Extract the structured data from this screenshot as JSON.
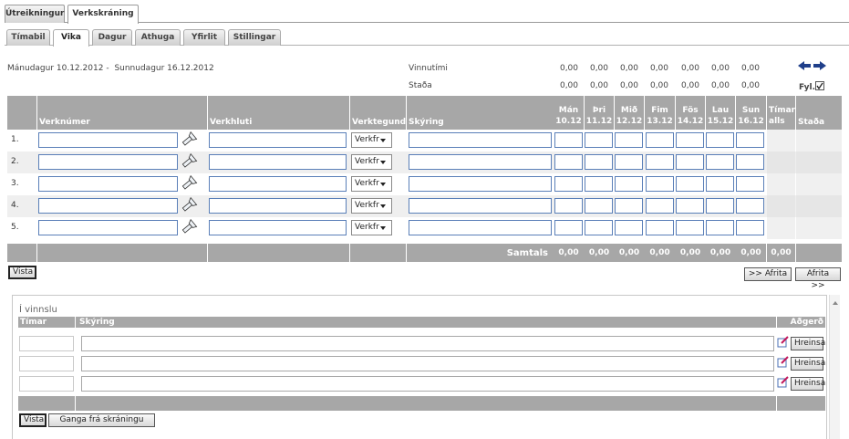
{
  "top_tabs": [
    {
      "label": "Útreikningur",
      "active": false
    },
    {
      "label": "Verkskráning",
      "active": true
    }
  ],
  "sub_tabs": [
    {
      "label": "Tímabil",
      "active": false
    },
    {
      "label": "Vika",
      "active": true
    },
    {
      "label": "Dagur",
      "active": false
    },
    {
      "label": "Athuga",
      "active": false
    },
    {
      "label": "Yfirlit",
      "active": false
    },
    {
      "label": "Stillingar",
      "active": false
    }
  ],
  "period": {
    "start": "Mánudagur 10.12.2012",
    "separator": "-",
    "end": "Sunnudagur 16.12.2012"
  },
  "summary": {
    "vinnutimi_label": "Vinnutími",
    "vinnutimi_values": [
      "0,00",
      "0,00",
      "0,00",
      "0,00",
      "0,00",
      "0,00",
      "0,00"
    ],
    "stada_label": "Staða",
    "stada_values": [
      "0,00",
      "0,00",
      "0,00",
      "0,00",
      "0,00",
      "0,00",
      "0,00"
    ],
    "fyl_label": "Fyl.",
    "fyl_checked": true
  },
  "grid": {
    "headers": {
      "verknumer": "Verknúmer",
      "verkhluti": "Verkhluti",
      "verktegund": "Verktegund",
      "skyring": "Skýring",
      "timar_line1": "Tímar",
      "timar_line2": "alls",
      "stada": "Staða"
    },
    "days": [
      {
        "name": "Mán",
        "date": "10.12"
      },
      {
        "name": "Þri",
        "date": "11.12"
      },
      {
        "name": "Mið",
        "date": "12.12"
      },
      {
        "name": "Fim",
        "date": "13.12"
      },
      {
        "name": "Fös",
        "date": "14.12"
      },
      {
        "name": "Lau",
        "date": "15.12"
      },
      {
        "name": "Sun",
        "date": "16.12"
      }
    ],
    "rows": [
      {
        "num": "1.",
        "verktegund": "Verkfr"
      },
      {
        "num": "2.",
        "verktegund": "Verkfr"
      },
      {
        "num": "3.",
        "verktegund": "Verkfr"
      },
      {
        "num": "4.",
        "verktegund": "Verkfr"
      },
      {
        "num": "5.",
        "verktegund": "Verkfr"
      }
    ],
    "totals_label": "Samtals",
    "totals": [
      "0,00",
      "0,00",
      "0,00",
      "0,00",
      "0,00",
      "0,00",
      "0,00"
    ],
    "total_all": "0,00"
  },
  "buttons": {
    "vista": "Vista",
    "afrita_prev": ">> Afrita",
    "afrita_next": "Afrita >>"
  },
  "panel": {
    "title": "Í vinnslu",
    "headers": {
      "timar": "Tímar",
      "skyring": "Skýring",
      "adgerd": "Aðgerð"
    },
    "rows": [
      {
        "button": "Hreinsa"
      },
      {
        "button": "Hreinsa"
      },
      {
        "button": "Hreinsa"
      }
    ],
    "vista": "Vista",
    "ganga": "Ganga frá skráningu"
  }
}
